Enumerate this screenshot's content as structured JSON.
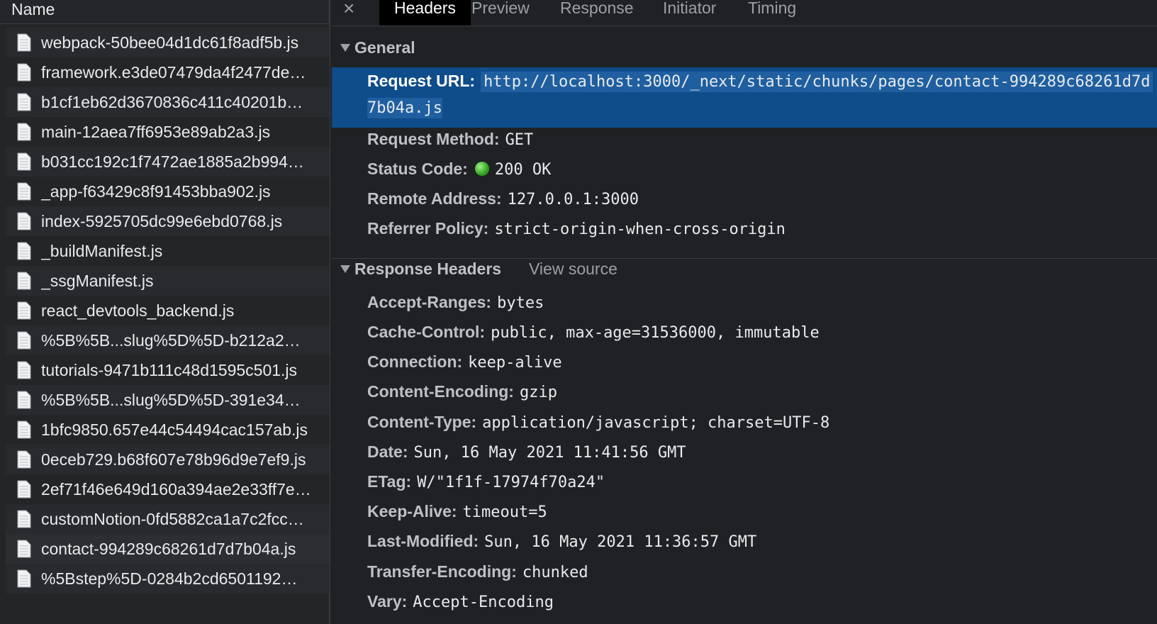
{
  "left_panel": {
    "column_header": "Name",
    "files": [
      "webpack-50bee04d1dc61f8adf5b.js",
      "framework.e3de07479da4f2477de…",
      "b1cf1eb62d3670836c411c40201b…",
      "main-12aea7ff6953e89ab2a3.js",
      "b031cc192c1f7472ae1885a2b994…",
      "_app-f63429c8f91453bba902.js",
      "index-5925705dc99e6ebd0768.js",
      "_buildManifest.js",
      "_ssgManifest.js",
      "react_devtools_backend.js",
      "%5B%5B...slug%5D%5D-b212a2…",
      "tutorials-9471b111c48d1595c501.js",
      "%5B%5B...slug%5D%5D-391e34…",
      "1bfc9850.657e44c54494cac157ab.js",
      "0eceb729.b68f607e78b96d9e7ef9.js",
      "2ef71f46e649d160a394ae2e33ff7e…",
      "customNotion-0fd5882ca1a7c2fcc…",
      "contact-994289c68261d7d7b04a.js",
      "%5Bstep%5D-0284b2cd6501192…"
    ]
  },
  "tabs": {
    "close": "×",
    "headers": "Headers",
    "preview": "Preview",
    "response": "Response",
    "initiator": "Initiator",
    "timing": "Timing"
  },
  "general": {
    "title": "General",
    "request_url_key": "Request URL:",
    "request_url_part1": "http://localhost:3000/_next/static/chunks/pages/contact-994289c68261d7d",
    "request_url_part2": "7b04a.js",
    "rows": [
      {
        "key": "Request Method:",
        "value": "GET"
      },
      {
        "key": "Status Code:",
        "value": "200 OK"
      },
      {
        "key": "Remote Address:",
        "value": "127.0.0.1:3000"
      },
      {
        "key": "Referrer Policy:",
        "value": "strict-origin-when-cross-origin"
      }
    ]
  },
  "response_headers": {
    "title": "Response Headers",
    "view_source": "View source",
    "rows": [
      {
        "key": "Accept-Ranges:",
        "value": "bytes"
      },
      {
        "key": "Cache-Control:",
        "value": "public, max-age=31536000, immutable"
      },
      {
        "key": "Connection:",
        "value": "keep-alive"
      },
      {
        "key": "Content-Encoding:",
        "value": "gzip"
      },
      {
        "key": "Content-Type:",
        "value": "application/javascript; charset=UTF-8"
      },
      {
        "key": "Date:",
        "value": "Sun, 16 May 2021 11:41:56 GMT"
      },
      {
        "key": "ETag:",
        "value": "W/\"1f1f-17974f70a24\""
      },
      {
        "key": "Keep-Alive:",
        "value": "timeout=5"
      },
      {
        "key": "Last-Modified:",
        "value": "Sun, 16 May 2021 11:36:57 GMT"
      },
      {
        "key": "Transfer-Encoding:",
        "value": "chunked"
      },
      {
        "key": "Vary:",
        "value": "Accept-Encoding"
      }
    ]
  },
  "colors": {
    "selected_row": "#0e4c8a",
    "status_ok": "#2ea31e"
  }
}
